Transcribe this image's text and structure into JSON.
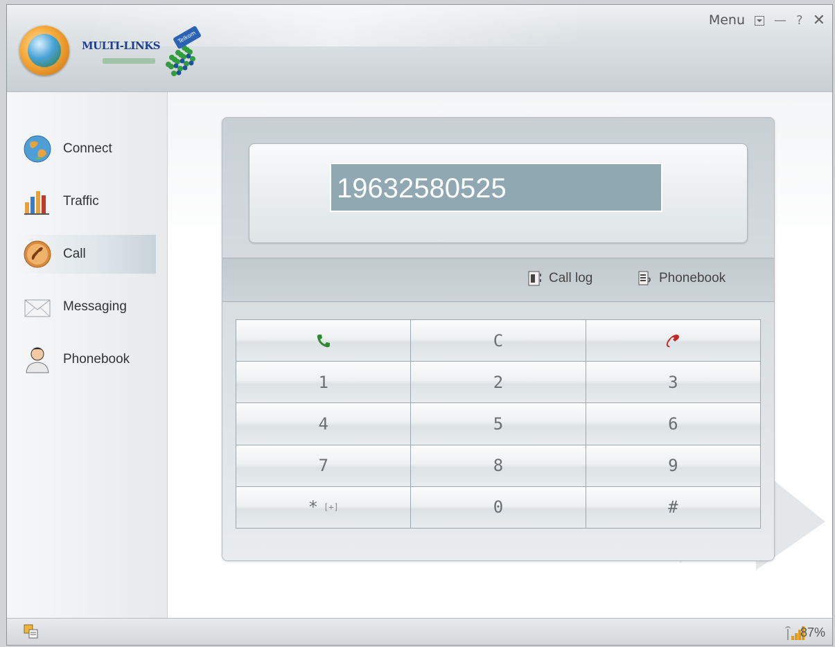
{
  "app": {
    "brand": "MULTI-LINKS",
    "trademark": "Telkom"
  },
  "window_controls": {
    "menu_label": "Menu"
  },
  "sidebar": {
    "items": [
      {
        "label": "Connect",
        "icon": "globe-icon"
      },
      {
        "label": "Traffic",
        "icon": "bar-chart-icon"
      },
      {
        "label": "Call",
        "icon": "phone-icon",
        "active": true
      },
      {
        "label": "Messaging",
        "icon": "envelope-icon"
      },
      {
        "label": "Phonebook",
        "icon": "person-icon"
      }
    ]
  },
  "dialer": {
    "number": "19632580525",
    "call_log_label": "Call log",
    "phonebook_label": "Phonebook",
    "keys": [
      {
        "label": "",
        "icon": "call-icon"
      },
      {
        "label": "C",
        "icon": ""
      },
      {
        "label": "",
        "icon": "hangup-icon"
      },
      {
        "label": "1",
        "icon": ""
      },
      {
        "label": "2",
        "icon": ""
      },
      {
        "label": "3",
        "icon": ""
      },
      {
        "label": "4",
        "icon": ""
      },
      {
        "label": "5",
        "icon": ""
      },
      {
        "label": "6",
        "icon": ""
      },
      {
        "label": "7",
        "icon": ""
      },
      {
        "label": "8",
        "icon": ""
      },
      {
        "label": "9",
        "icon": ""
      },
      {
        "label": "*",
        "sub": "[+]",
        "icon": ""
      },
      {
        "label": "0",
        "icon": ""
      },
      {
        "label": "#",
        "icon": ""
      }
    ]
  },
  "status": {
    "battery": "87%"
  }
}
